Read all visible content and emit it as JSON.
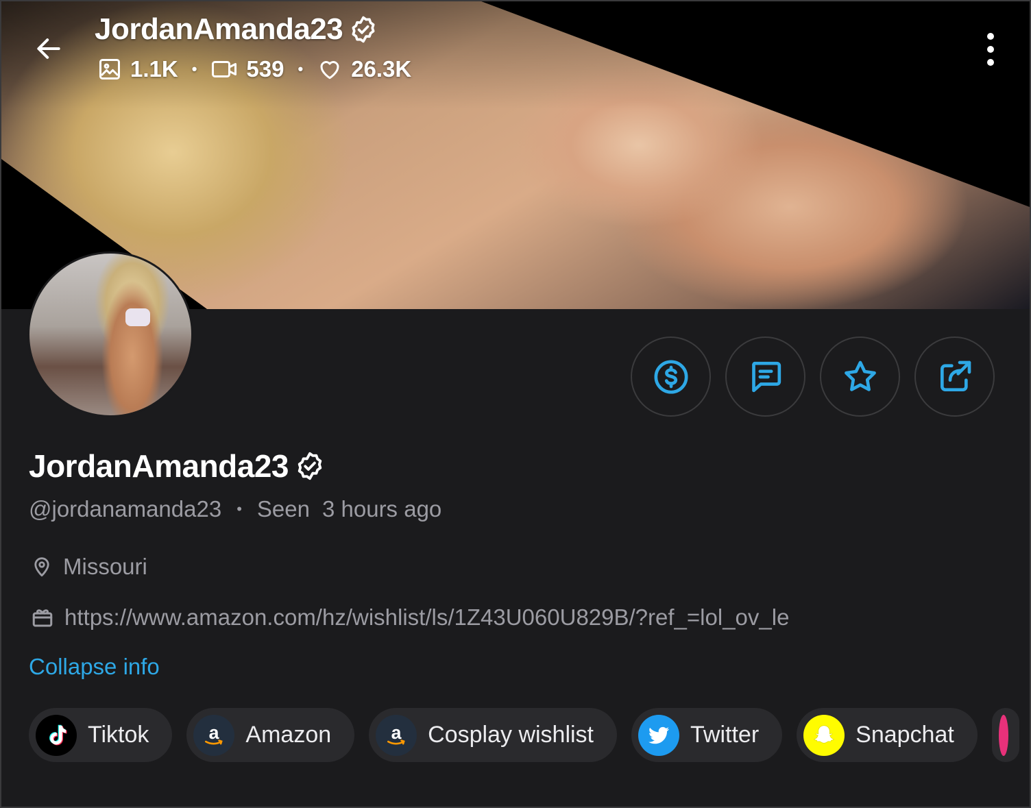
{
  "header": {
    "back_label": "Back",
    "display_name": "JordanAmanda23",
    "stats": {
      "photos": "1.1K",
      "videos": "539",
      "likes": "26.3K"
    }
  },
  "profile": {
    "display_name": "JordanAmanda23",
    "username": "@jordanamanda23",
    "seen_label": "Seen",
    "seen_time": "3 hours ago",
    "location": "Missouri",
    "wishlist_url": "https://www.amazon.com/hz/wishlist/ls/1Z43U060U829B/?ref_=lol_ov_le",
    "collapse_label": "Collapse info"
  },
  "actions": [
    {
      "icon": "tip-dollar-icon"
    },
    {
      "icon": "message-icon"
    },
    {
      "icon": "star-icon"
    },
    {
      "icon": "share-icon"
    }
  ],
  "social_links": [
    {
      "label": "Tiktok",
      "icon": "tiktok-icon"
    },
    {
      "label": "Amazon",
      "icon": "amazon-icon"
    },
    {
      "label": "Cosplay wishlist",
      "icon": "amazon-icon"
    },
    {
      "label": "Twitter",
      "icon": "twitter-icon"
    },
    {
      "label": "Snapchat",
      "icon": "snapchat-icon"
    }
  ],
  "colors": {
    "background": "#1b1b1d",
    "accent": "#2ea8e6",
    "muted_text": "#9c9ca3",
    "chip_bg": "#2a2a2d",
    "twitter": "#1d9bf0",
    "snapchat": "#fffc00"
  }
}
